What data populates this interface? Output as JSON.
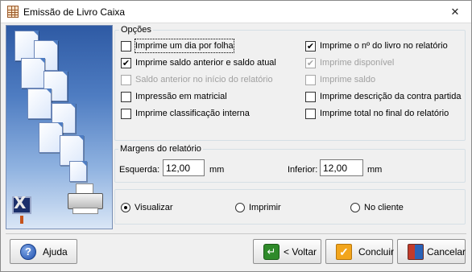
{
  "window": {
    "title": "Emissão de Livro Caixa",
    "close_glyph": "✕"
  },
  "opcoes": {
    "title": "Opções",
    "check_glyph": "✔",
    "left": [
      {
        "label": "Imprime um dia por folha",
        "checked": false,
        "disabled": false
      },
      {
        "label": "Imprime saldo anterior e saldo atual",
        "checked": true,
        "disabled": false
      },
      {
        "label": "Saldo anterior no início do relatório",
        "checked": false,
        "disabled": true
      },
      {
        "label": "Impressão em matricial",
        "checked": false,
        "disabled": false
      },
      {
        "label": "Imprime classificação interna",
        "checked": false,
        "disabled": false
      }
    ],
    "right": [
      {
        "label": "Imprime o nº do livro no relatório",
        "checked": true,
        "disabled": false
      },
      {
        "label": "Imprime disponível",
        "checked": true,
        "disabled": true
      },
      {
        "label": "Imprime saldo",
        "checked": false,
        "disabled": true
      },
      {
        "label": "Imprime descrição da contra partida",
        "checked": false,
        "disabled": false
      },
      {
        "label": "Imprime total no final do relatório",
        "checked": false,
        "disabled": false
      }
    ]
  },
  "margens": {
    "title": "Margens do relatório",
    "esquerda_label": "Esquerda:",
    "esquerda_value": "12,00",
    "esquerda_unit": "mm",
    "inferior_label": "Inferior:",
    "inferior_value": "12,00",
    "inferior_unit": "mm"
  },
  "output": {
    "options": [
      {
        "label": "Visualizar",
        "selected": true
      },
      {
        "label": "Imprimir",
        "selected": false
      },
      {
        "label": "No cliente",
        "selected": false
      }
    ]
  },
  "buttons": {
    "help": "Ajuda",
    "back": "< Voltar",
    "finish": "Concluir",
    "cancel": "Cancelar"
  },
  "icons": {
    "help": "?",
    "back": "↵",
    "finish": "✓"
  }
}
